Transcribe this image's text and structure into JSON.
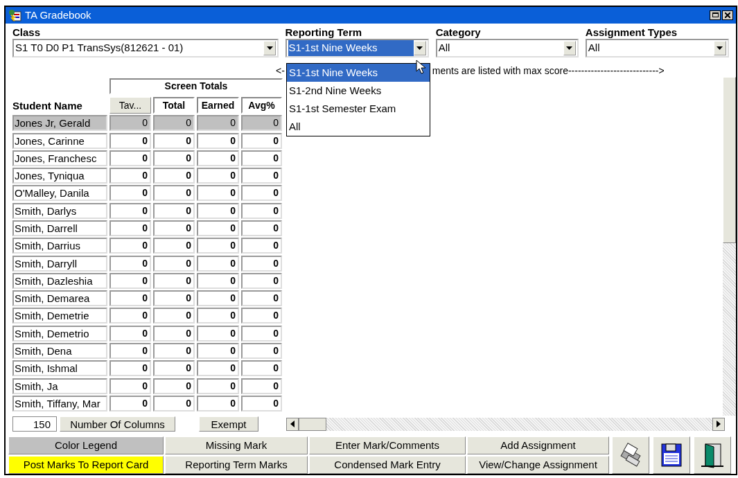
{
  "window": {
    "title": "TA Gradebook"
  },
  "filters": [
    {
      "label": "Class",
      "value": "S1 T0 D0 P1 TransSys(812621 - 01)",
      "focused": false
    },
    {
      "label": "Reporting Term",
      "value": "S1-1st Nine Weeks",
      "focused": true
    },
    {
      "label": "Category",
      "value": "All",
      "focused": false
    },
    {
      "label": "Assignment Types",
      "value": "All",
      "focused": false
    }
  ],
  "term_dropdown": {
    "options": [
      {
        "label": "S1-1st Nine Weeks",
        "selected": true
      },
      {
        "label": "S1-2nd Nine Weeks",
        "selected": false
      },
      {
        "label": "S1-1st Semester Exam",
        "selected": false
      },
      {
        "label": "All",
        "selected": false
      }
    ]
  },
  "hint": {
    "left": "<-",
    "right": "ments are listed with max score---------------------------->"
  },
  "table": {
    "group_header": "Screen Totals",
    "name_header": "Student Name",
    "columns": [
      {
        "label": "Tav...",
        "kind": "button"
      },
      {
        "label": "Total",
        "kind": "header"
      },
      {
        "label": "Earned",
        "kind": "header"
      },
      {
        "label": "Avg%",
        "kind": "header"
      }
    ],
    "rows": [
      {
        "name": "Jones Jr, Gerald",
        "values": [
          "0",
          "0",
          "0",
          "0"
        ],
        "selected": true
      },
      {
        "name": "Jones, Carinne",
        "values": [
          "0",
          "0",
          "0",
          "0"
        ],
        "selected": false
      },
      {
        "name": "Jones, Franchesc",
        "values": [
          "0",
          "0",
          "0",
          "0"
        ],
        "selected": false
      },
      {
        "name": "Jones, Tyniqua",
        "values": [
          "0",
          "0",
          "0",
          "0"
        ],
        "selected": false
      },
      {
        "name": "O'Malley, Danila",
        "values": [
          "0",
          "0",
          "0",
          "0"
        ],
        "selected": false
      },
      {
        "name": "Smith, Darlys",
        "values": [
          "0",
          "0",
          "0",
          "0"
        ],
        "selected": false
      },
      {
        "name": "Smith, Darrell",
        "values": [
          "0",
          "0",
          "0",
          "0"
        ],
        "selected": false
      },
      {
        "name": "Smith, Darrius",
        "values": [
          "0",
          "0",
          "0",
          "0"
        ],
        "selected": false
      },
      {
        "name": "Smith, Darryll",
        "values": [
          "0",
          "0",
          "0",
          "0"
        ],
        "selected": false
      },
      {
        "name": "Smith, Dazleshia",
        "values": [
          "0",
          "0",
          "0",
          "0"
        ],
        "selected": false
      },
      {
        "name": "Smith, Demarea",
        "values": [
          "0",
          "0",
          "0",
          "0"
        ],
        "selected": false
      },
      {
        "name": "Smith, Demetrie",
        "values": [
          "0",
          "0",
          "0",
          "0"
        ],
        "selected": false
      },
      {
        "name": "Smith, Demetrio",
        "values": [
          "0",
          "0",
          "0",
          "0"
        ],
        "selected": false
      },
      {
        "name": "Smith, Dena",
        "values": [
          "0",
          "0",
          "0",
          "0"
        ],
        "selected": false
      },
      {
        "name": "Smith, Ishmal",
        "values": [
          "0",
          "0",
          "0",
          "0"
        ],
        "selected": false
      },
      {
        "name": "Smith, Ja",
        "values": [
          "0",
          "0",
          "0",
          "0"
        ],
        "selected": false
      },
      {
        "name": "Smith, Tiffany, Mar",
        "values": [
          "0",
          "0",
          "0",
          "0"
        ],
        "selected": false
      }
    ]
  },
  "columns_field": {
    "value": "150",
    "button": "Number Of Columns"
  },
  "exempt_button": "Exempt",
  "actions": [
    {
      "label": "Color Legend",
      "color": "#c0c0c0"
    },
    {
      "label": "Missing Mark",
      "color": "#e6e6dc"
    },
    {
      "label": "Enter Mark/Comments",
      "color": "#e6e6dc"
    },
    {
      "label": "Add Assignment",
      "color": "#e6e6dc"
    },
    {
      "label": "Post Marks To Report Card",
      "color": "#ffff00"
    },
    {
      "label": "Reporting Term Marks",
      "color": "#e6e6dc"
    },
    {
      "label": "Condensed Mark Entry",
      "color": "#e6e6dc"
    },
    {
      "label": "View/Change Assignment",
      "color": "#e6e6dc"
    }
  ],
  "tools": [
    {
      "kind": "print"
    },
    {
      "kind": "save"
    },
    {
      "kind": "exit"
    }
  ]
}
